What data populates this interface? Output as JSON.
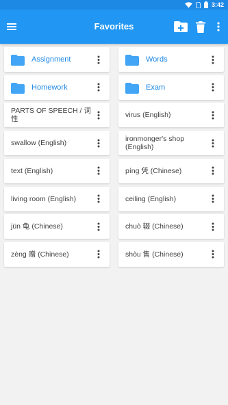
{
  "status_bar": {
    "time": "3:42",
    "icons": [
      "wifi-icon",
      "sim-icon",
      "battery-icon"
    ]
  },
  "app_bar": {
    "title": "Favorites",
    "left_icon": "menu-icon",
    "actions": [
      "add-folder-icon",
      "delete-icon",
      "more-vert-icon"
    ],
    "color": "#2196f3"
  },
  "items": [
    {
      "label": "Assignment",
      "kind": "folder"
    },
    {
      "label": "Words",
      "kind": "folder"
    },
    {
      "label": "Homework",
      "kind": "folder"
    },
    {
      "label": "Exam",
      "kind": "folder"
    },
    {
      "label": "PARTS OF SPEECH / 词性",
      "kind": "entry"
    },
    {
      "label": "virus (English)",
      "kind": "entry"
    },
    {
      "label": "swallow (English)",
      "kind": "entry"
    },
    {
      "label": "ironmonger's shop (English)",
      "kind": "entry"
    },
    {
      "label": "text (English)",
      "kind": "entry"
    },
    {
      "label": "píng 凭 (Chinese)",
      "kind": "entry"
    },
    {
      "label": "living room (English)",
      "kind": "entry"
    },
    {
      "label": "ceiling (English)",
      "kind": "entry"
    },
    {
      "label": "jūn 龟 (Chinese)",
      "kind": "entry"
    },
    {
      "label": "chuò 辍 (Chinese)",
      "kind": "entry"
    },
    {
      "label": "zèng 赠 (Chinese)",
      "kind": "entry"
    },
    {
      "label": "shòu 售 (Chinese)",
      "kind": "entry"
    }
  ],
  "colors": {
    "folder": "#42a5f5",
    "folder_text": "#1e88e5",
    "entry_text": "#424242"
  }
}
